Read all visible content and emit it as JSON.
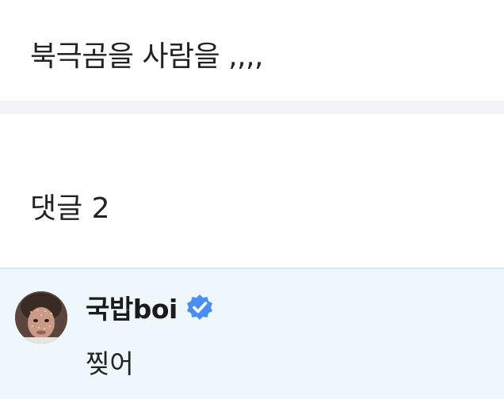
{
  "post": {
    "text": "북극곰을 사람을 ,,,,"
  },
  "comments": {
    "header": "댓글 2",
    "items": [
      {
        "author": "국밥boi",
        "verified": true,
        "text": "찢어"
      }
    ]
  },
  "colors": {
    "divider": "#f3f4f7",
    "highlighted_comment_bg": "#eef7fb",
    "verified_badge": "#4a8ff0"
  },
  "icons": {
    "verified": "verified-badge-icon",
    "avatar": "user-avatar"
  }
}
